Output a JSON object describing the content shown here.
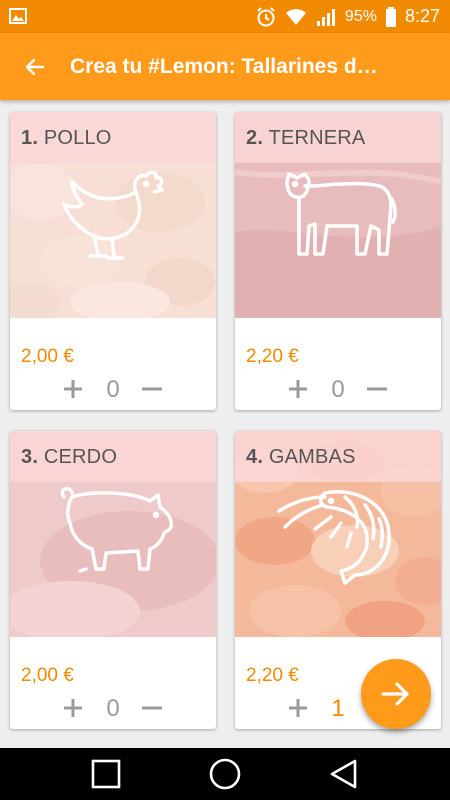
{
  "status_bar": {
    "battery": "95%",
    "time": "8:27",
    "icons": [
      "image-icon",
      "alarm-icon",
      "wifi-icon",
      "signal-icon",
      "battery-icon"
    ]
  },
  "app_bar": {
    "title": "Crea tu #Lemon: Tallarines d…",
    "back_icon": "arrow-left-icon"
  },
  "products": [
    {
      "number": "1.",
      "name": "POLLO",
      "price": "2,00 €",
      "plus": "+",
      "quantity": "0",
      "minus": "−",
      "icon": "chicken-icon"
    },
    {
      "number": "2.",
      "name": "TERNERA",
      "price": "2,20 €",
      "plus": "+",
      "quantity": "0",
      "minus": "−",
      "icon": "cow-icon"
    },
    {
      "number": "3.",
      "name": "CERDO",
      "price": "2,00 €",
      "plus": "+",
      "quantity": "0",
      "minus": "−",
      "icon": "pig-icon"
    },
    {
      "number": "4.",
      "name": "GAMBAS",
      "price": "2,20 €",
      "plus": "+",
      "quantity": "1",
      "minus": "−",
      "icon": "shrimp-icon"
    }
  ],
  "fab": {
    "icon": "arrow-right-icon"
  },
  "nav_bar": {
    "icons": [
      "recents-square-icon",
      "home-circle-icon",
      "back-triangle-icon"
    ]
  },
  "colors": {
    "status_bar": "#f28a00",
    "app_bar": "#ff9a1a",
    "accent": "#f28a00",
    "quantity_inactive": "#999999"
  }
}
